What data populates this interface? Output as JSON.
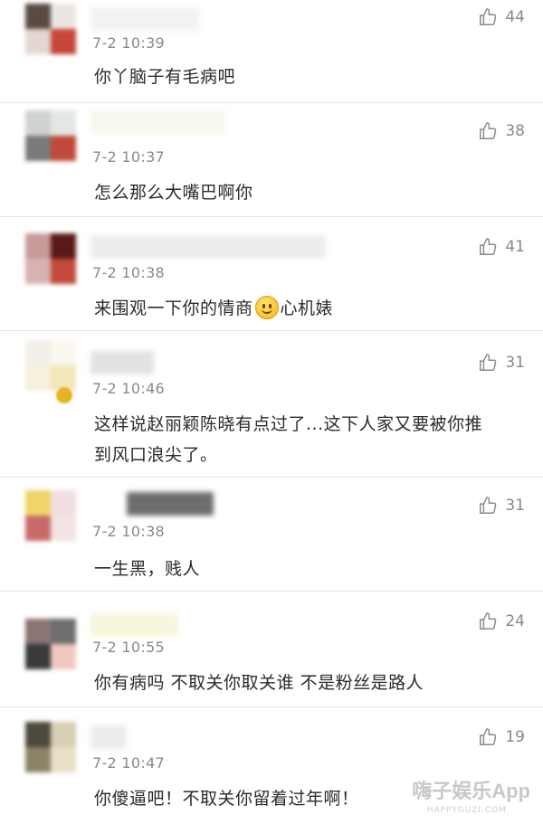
{
  "comments": [
    {
      "time": "7-2 10:39",
      "text": "你丫脑子有毛病吧",
      "likes": "44"
    },
    {
      "time": "7-2 10:37",
      "text": "怎么那么大嘴巴啊你",
      "likes": "38"
    },
    {
      "time": "7-2 10:38",
      "text_before": "来围观一下你的情商",
      "text_after": "心机婊",
      "likes": "41"
    },
    {
      "time": "7-2 10:46",
      "text": "这样说赵丽颖陈晓有点过了...这下人家又要被你推到风口浪尖了。",
      "likes": "31"
    },
    {
      "time": "7-2 10:38",
      "text": "一生黑，贱人",
      "likes": "31"
    },
    {
      "time": "7-2 10:55",
      "text": "你有病吗 不取关你取关谁 不是粉丝是路人",
      "likes": "24"
    },
    {
      "time": "7-2 10:47",
      "text": "你傻逼吧！不取关你留着过年啊！",
      "likes": "19"
    }
  ],
  "watermark": {
    "main": "嗨子娱乐App",
    "sub": "HAPPYGUZI.COM"
  },
  "colors": {
    "text": "#2b2b2b",
    "meta": "#8a8a8a",
    "divider": "#e6e6e6"
  },
  "icons": {
    "like": "thumbs-up-icon",
    "emoji": "smile-emoji-icon"
  }
}
